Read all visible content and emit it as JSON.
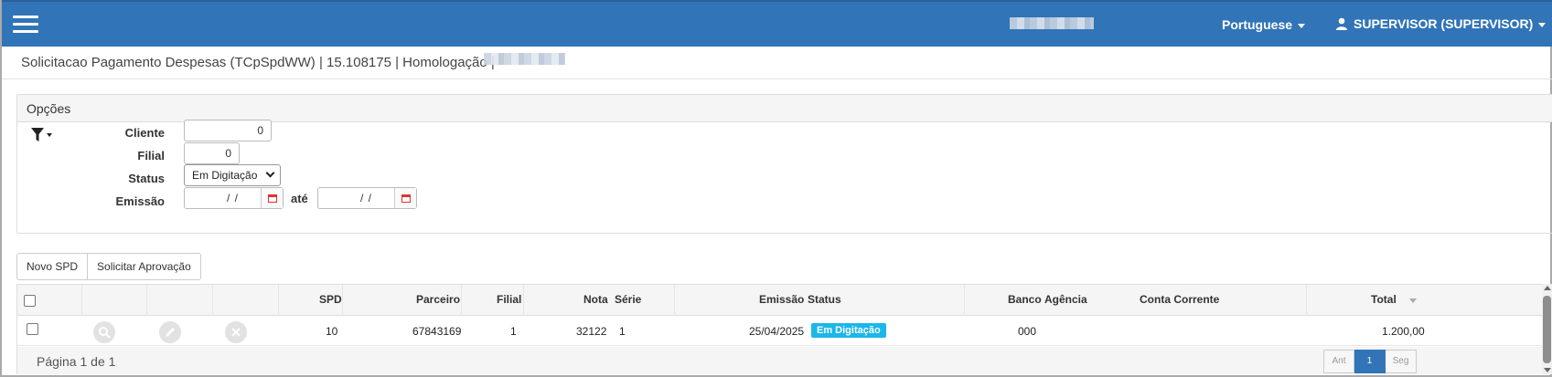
{
  "header": {
    "language": "Portuguese",
    "user": "SUPERVISOR (SUPERVISOR)"
  },
  "page": {
    "title": "Solicitacao Pagamento Despesas (TCpSpdWW) | 15.108175 | Homologação |"
  },
  "options": {
    "heading": "Opções",
    "fields": {
      "cliente": {
        "label": "Cliente",
        "value": "0"
      },
      "filial": {
        "label": "Filial",
        "value": "0"
      },
      "status": {
        "label": "Status",
        "value": "Em Digitação"
      },
      "emissao": {
        "label": "Emissão",
        "from": "/ /",
        "separator": "até",
        "to": "/ /"
      }
    }
  },
  "toolbar": {
    "new_label": "Novo SPD",
    "approve_label": "Solicitar Aprovação"
  },
  "grid": {
    "columns": {
      "spd": "SPD",
      "parceiro": "Parceiro",
      "filial": "Filial",
      "nota": "Nota",
      "serie": "Série",
      "emissao": "Emissão",
      "status": "Status",
      "banco": "Banco",
      "agencia": "Agência",
      "conta": "Conta Corrente",
      "total": "Total"
    },
    "rows": [
      {
        "spd": "10",
        "parceiro": "67843169",
        "filial": "1",
        "nota": "32122",
        "serie": "1",
        "emissao": "25/04/2025",
        "status": "Em Digitação",
        "banco": "000",
        "agencia": "",
        "conta": "",
        "total": "1.200,00"
      }
    ],
    "footer": {
      "page_info": "Página 1 de 1",
      "prev": "Ant",
      "current": "1",
      "next": "Seg"
    }
  },
  "colors": {
    "header_bg": "#3174b7",
    "badge_bg": "#1ab7ea"
  }
}
